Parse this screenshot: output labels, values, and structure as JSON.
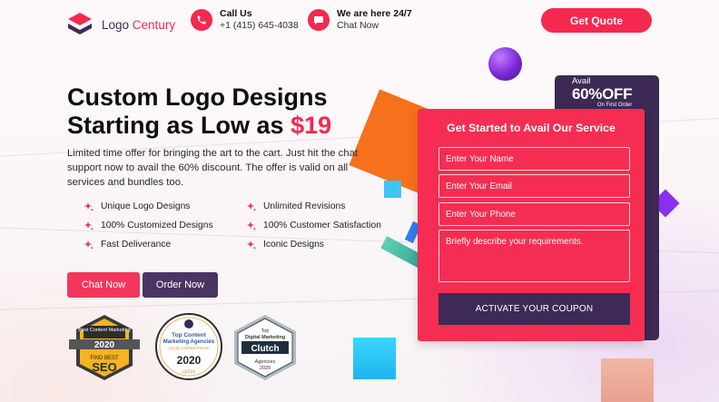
{
  "header": {
    "logo": {
      "text_main": "Logo ",
      "text_accent": "Century"
    },
    "call": {
      "title": "Call Us",
      "value": "+1 (415) 645-4038"
    },
    "chat": {
      "title": "We are here 24/7",
      "value": "Chat Now"
    },
    "quote_button": "Get Quote"
  },
  "hero": {
    "title_line1": "Custom Logo Designs",
    "title_line2_prefix": "Starting as Low as ",
    "price": "$19",
    "description": "Limited time offer for bringing the art to the cart. Just hit the chat support now to avail the 60% discount. The offer is valid on all services and bundles too.",
    "features": [
      "Unique Logo Designs",
      "Unlimited Revisions",
      "100% Customized Designs",
      "100% Customer Satisfaction",
      "Fast Deliverance",
      "Iconic Designs"
    ],
    "chat_button": "Chat Now",
    "order_button": "Order Now"
  },
  "badges": {
    "seo": {
      "top": "Best Content Marketing",
      "year": "2020",
      "bottom1": "FIND BEST",
      "bottom2": "SEO"
    },
    "upcity": {
      "line1": "Top Content",
      "line2": "Marketing Agencies",
      "line3": "UpCity Certified Partner",
      "year": "2020",
      "brand": "upCity"
    },
    "clutch": {
      "line1": "Top",
      "line2": "Digital Marketing",
      "brand": "Clutch",
      "line3": "Agencies",
      "year": "2020"
    }
  },
  "offer": {
    "avail": "Avail",
    "discount": "60%OFF",
    "note": "On First Order"
  },
  "form": {
    "title": "Get Started to Avail Our Service",
    "name_placeholder": "Enter Your Name",
    "email_placeholder": "Enter Your Email",
    "phone_placeholder": "Enter Your Phone",
    "message_placeholder": "Briefly describe your requirements.",
    "submit": "ACTIVATE YOUR COUPON"
  },
  "colors": {
    "accent": "#f5294f",
    "dark": "#3c2a55",
    "orange": "#f7701c",
    "purple": "#7a33e6",
    "cyan": "#35d0f5"
  }
}
